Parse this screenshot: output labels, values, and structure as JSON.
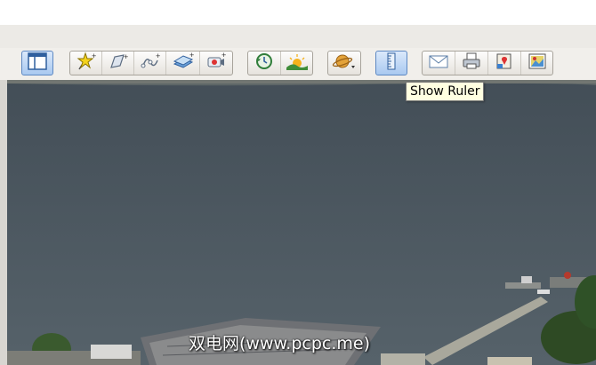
{
  "toolbar": {
    "buttons": [
      {
        "name": "sidebar-toggle",
        "icon": "sidebar-icon",
        "active": true
      },
      {
        "name": "add-placemark",
        "icon": "placemark-pin-icon"
      },
      {
        "name": "add-polygon",
        "icon": "polygon-icon"
      },
      {
        "name": "add-path",
        "icon": "path-icon"
      },
      {
        "name": "add-image-overlay",
        "icon": "image-overlay-icon"
      },
      {
        "name": "record-tour",
        "icon": "record-tour-icon"
      },
      {
        "name": "historical-imagery",
        "icon": "historical-clock-icon"
      },
      {
        "name": "sunlight",
        "icon": "sunlight-icon"
      },
      {
        "name": "switch-planet",
        "icon": "planet-icon"
      },
      {
        "name": "show-ruler",
        "icon": "ruler-icon",
        "active": true
      },
      {
        "name": "email",
        "icon": "envelope-icon"
      },
      {
        "name": "print",
        "icon": "printer-icon"
      },
      {
        "name": "view-in-maps",
        "icon": "maps-icon"
      },
      {
        "name": "save-image",
        "icon": "save-image-icon"
      }
    ]
  },
  "tooltip": {
    "text": "Show Ruler"
  },
  "watermark": {
    "text": "双电网(www.pcpc.me)"
  },
  "colors": {
    "water": "#4a555d",
    "toolbar": "#f1efeb",
    "active": "#a9c9f0",
    "tooltip_bg": "#ffffe1"
  }
}
